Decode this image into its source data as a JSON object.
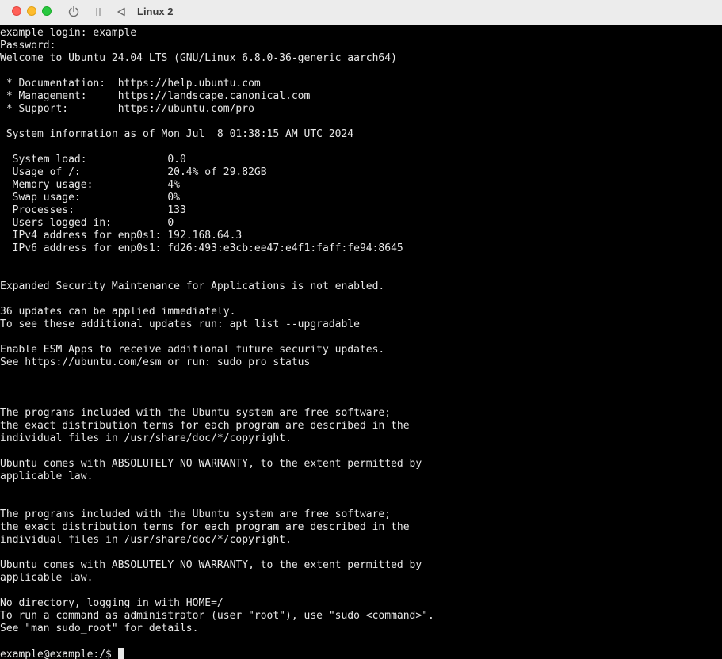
{
  "window": {
    "title": "Linux 2",
    "icons": {
      "power": "power-icon",
      "pause": "pause-icon",
      "back": "back-triangle-icon"
    },
    "colors": {
      "close": "#ff5f57",
      "minimize": "#febc2e",
      "zoom": "#28c840",
      "terminal_bg": "#000000",
      "terminal_fg": "#e8e8e8"
    }
  },
  "terminal": {
    "lines": [
      "example login: example",
      "Password:",
      "Welcome to Ubuntu 24.04 LTS (GNU/Linux 6.8.0-36-generic aarch64)",
      "",
      " * Documentation:  https://help.ubuntu.com",
      " * Management:     https://landscape.canonical.com",
      " * Support:        https://ubuntu.com/pro",
      "",
      " System information as of Mon Jul  8 01:38:15 AM UTC 2024",
      "",
      "  System load:             0.0",
      "  Usage of /:              20.4% of 29.82GB",
      "  Memory usage:            4%",
      "  Swap usage:              0%",
      "  Processes:               133",
      "  Users logged in:         0",
      "  IPv4 address for enp0s1: 192.168.64.3",
      "  IPv6 address for enp0s1: fd26:493:e3cb:ee47:e4f1:faff:fe94:8645",
      "",
      "",
      "Expanded Security Maintenance for Applications is not enabled.",
      "",
      "36 updates can be applied immediately.",
      "To see these additional updates run: apt list --upgradable",
      "",
      "Enable ESM Apps to receive additional future security updates.",
      "See https://ubuntu.com/esm or run: sudo pro status",
      "",
      "",
      "",
      "The programs included with the Ubuntu system are free software;",
      "the exact distribution terms for each program are described in the",
      "individual files in /usr/share/doc/*/copyright.",
      "",
      "Ubuntu comes with ABSOLUTELY NO WARRANTY, to the extent permitted by",
      "applicable law.",
      "",
      "",
      "The programs included with the Ubuntu system are free software;",
      "the exact distribution terms for each program are described in the",
      "individual files in /usr/share/doc/*/copyright.",
      "",
      "Ubuntu comes with ABSOLUTELY NO WARRANTY, to the extent permitted by",
      "applicable law.",
      "",
      "No directory, logging in with HOME=/",
      "To run a command as administrator (user \"root\"), use \"sudo <command>\".",
      "See \"man sudo_root\" for details.",
      ""
    ],
    "prompt": "example@example:/$ "
  }
}
